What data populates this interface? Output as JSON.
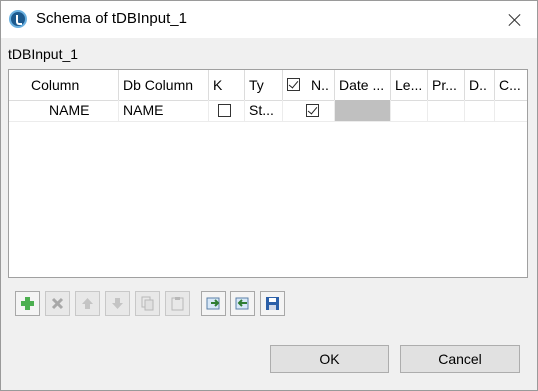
{
  "window": {
    "title": "Schema of tDBInput_1"
  },
  "component_label": "tDBInput_1",
  "table": {
    "columns": [
      "Column",
      "Db Column",
      "K",
      "Ty",
      "N..",
      "Date ...",
      "Le...",
      "Pr...",
      "D..",
      "C..."
    ],
    "header_nullable_checked": true,
    "rows": [
      {
        "column": "NAME",
        "db_column": "NAME",
        "key": false,
        "type": "St...",
        "nullable": true,
        "date_pattern": ""
      }
    ]
  },
  "toolbar": {
    "buttons": [
      {
        "icon": "add-icon",
        "enabled": true
      },
      {
        "icon": "delete-icon",
        "enabled": false
      },
      {
        "icon": "move-up-icon",
        "enabled": false
      },
      {
        "icon": "move-down-icon",
        "enabled": false
      },
      {
        "icon": "copy-icon",
        "enabled": false
      },
      {
        "icon": "paste-icon",
        "enabled": false
      },
      {
        "icon": "import-icon",
        "enabled": true
      },
      {
        "icon": "export-icon",
        "enabled": true
      },
      {
        "icon": "save-icon",
        "enabled": true
      }
    ]
  },
  "buttons": {
    "ok": "OK",
    "cancel": "Cancel"
  }
}
